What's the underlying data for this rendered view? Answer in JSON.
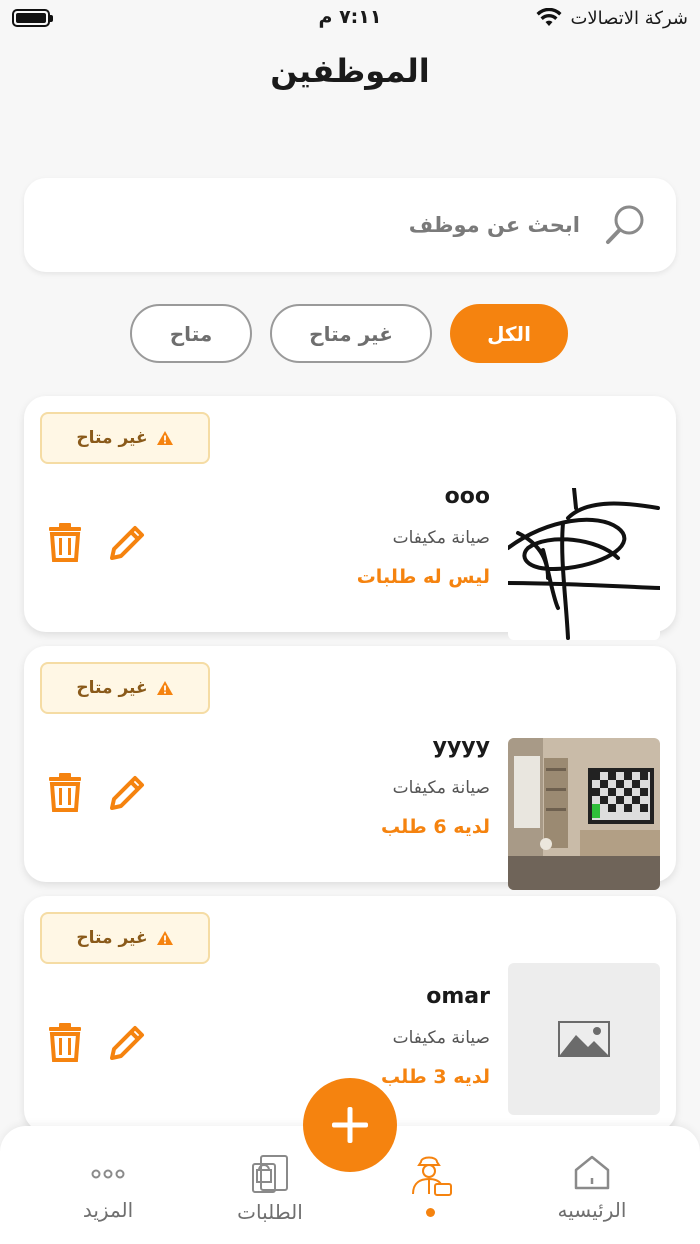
{
  "status_bar": {
    "carrier": "شركة الاتصالات",
    "time": "٧:١١ م"
  },
  "page_title": "الموظفين",
  "search": {
    "placeholder": "ابحث عن موظف",
    "value": ""
  },
  "filters": [
    {
      "label": "الكل",
      "selected": true
    },
    {
      "label": "غير متاح",
      "selected": false
    },
    {
      "label": "متاح",
      "selected": false
    }
  ],
  "employees": [
    {
      "status": "غير متاح",
      "name": "ooo",
      "role": "صيانة مكيفات",
      "orders": "ليس له طلبات",
      "image": "signature-scribble"
    },
    {
      "status": "غير متاح",
      "name": "yyyy",
      "role": "صيانة مكيفات",
      "orders": "لديه 6 طلب",
      "image": "room-photo"
    },
    {
      "status": "غير متاح",
      "name": "omar",
      "role": "صيانة مكيفات",
      "orders": "لديه 3 طلب",
      "image": "image-placeholder"
    }
  ],
  "bottom_nav": [
    {
      "label": "الرئيسيه",
      "icon": "home-icon"
    },
    {
      "label": "",
      "icon": "employee-icon",
      "active": true
    },
    {
      "label": "الطلبات",
      "icon": "orders-icon"
    },
    {
      "label": "المزيد",
      "icon": "more-icon"
    }
  ],
  "colors": {
    "accent": "#f5830f",
    "background": "#f7f7f7",
    "badge_bg": "#fff7e5",
    "badge_border": "#f5dca4"
  }
}
